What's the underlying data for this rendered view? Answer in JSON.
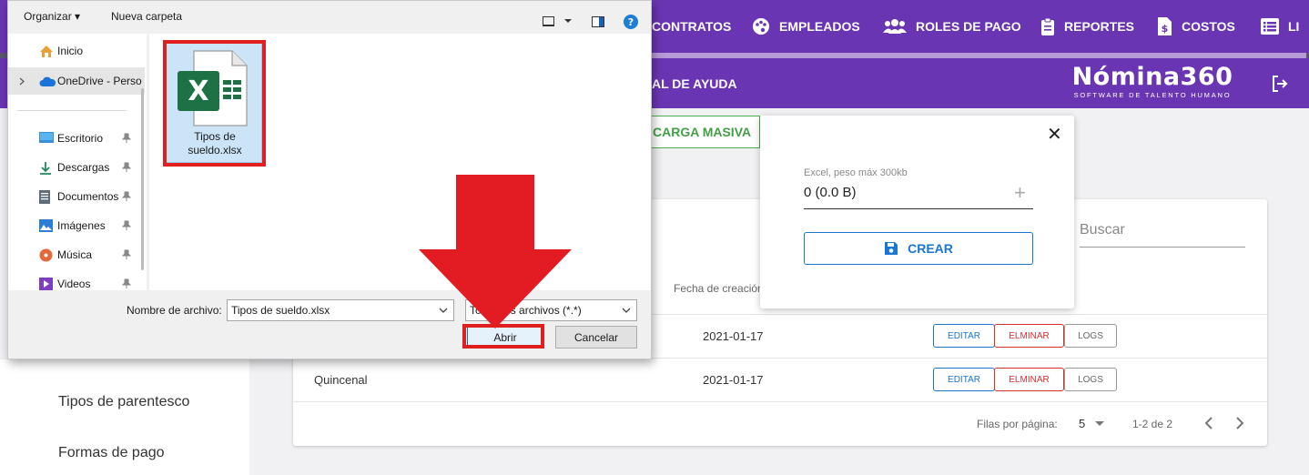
{
  "nav": {
    "items": [
      {
        "label": "CONTRATOS",
        "icon": "none"
      },
      {
        "label": "EMPLEADOS",
        "icon": "palette-icon"
      },
      {
        "label": "ROLES DE PAGO",
        "icon": "users-icon"
      },
      {
        "label": "REPORTES",
        "icon": "clipboard-icon"
      },
      {
        "label": "COSTOS",
        "icon": "file-dollar-icon"
      },
      {
        "label": "LI",
        "icon": "list-icon"
      }
    ]
  },
  "subbar": {
    "help_label": "AL DE AYUDA"
  },
  "brand": {
    "name": "Nómina360",
    "tagline": "SOFTWARE DE TALENTO HUMANO"
  },
  "left_menu": {
    "items": [
      "Tipos de parentesco",
      "Formas de pago"
    ]
  },
  "main": {
    "carga_masiva_label": "CARGA MASIVA",
    "search_placeholder": "Buscar",
    "column_header": "Fecha de creación",
    "rows": [
      {
        "name": "",
        "date": "2021-01-17"
      },
      {
        "name": "Quincenal",
        "date": "2021-01-17"
      }
    ],
    "row_actions": {
      "edit": "EDITAR",
      "delete": "ELMINAR",
      "logs": "LOGS"
    },
    "footer": {
      "rows_per_page_label": "Filas por página:",
      "rows_per_page_value": "5",
      "range": "1-2 de 2"
    }
  },
  "upload_popup": {
    "field_label": "Excel, peso máx 300kb",
    "field_value": "0 (0.0 B)",
    "create_label": "CREAR"
  },
  "file_dialog": {
    "toolbar": {
      "organize": "Organizar",
      "new_folder": "Nueva carpeta"
    },
    "nav_items": [
      {
        "label": "Inicio",
        "icon": "home-icon",
        "pinned": false
      },
      {
        "label": "OneDrive - Perso",
        "icon": "cloud-icon",
        "pinned": false
      },
      {
        "label": "Escritorio",
        "icon": "desktop-icon",
        "pinned": true
      },
      {
        "label": "Descargas",
        "icon": "download-icon",
        "pinned": true
      },
      {
        "label": "Documentos",
        "icon": "document-icon",
        "pinned": true
      },
      {
        "label": "Imágenes",
        "icon": "image-icon",
        "pinned": true
      },
      {
        "label": "Música",
        "icon": "music-icon",
        "pinned": true
      },
      {
        "label": "Videos",
        "icon": "video-icon",
        "pinned": true
      }
    ],
    "file": {
      "name_line1": "Tipos de",
      "name_line2": "sueldo.xlsx"
    },
    "filename_label": "Nombre de archivo:",
    "filename_value": "Tipos de sueldo.xlsx",
    "filetype_value": "Todos los archivos (*.*)",
    "open_label": "Abrir",
    "cancel_label": "Cancelar"
  },
  "colors": {
    "brand_purple": "#6a35b3",
    "annotation_red": "#e0201e",
    "excel_green": "#1e7145"
  }
}
